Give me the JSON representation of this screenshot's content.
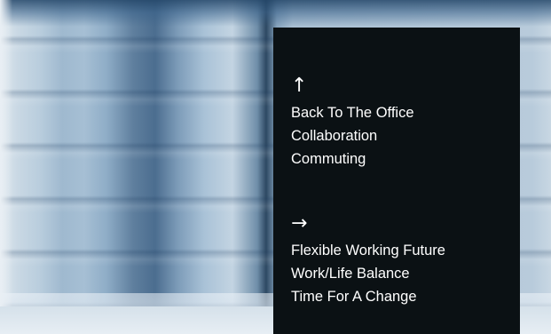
{
  "menu": {
    "group_up": {
      "icon": "arrow-up-icon",
      "glyph": "↑",
      "items": [
        "Back To The Office",
        "Collaboration",
        "Commuting"
      ]
    },
    "group_right": {
      "icon": "arrow-right-icon",
      "glyph": "→",
      "items": [
        "Flexible Working Future",
        "Work/Life Balance",
        "Time For A Change"
      ]
    }
  },
  "colors": {
    "panel_background": "#0b1114",
    "text": "#ffffff",
    "photo_tint": "#8fadc7"
  }
}
